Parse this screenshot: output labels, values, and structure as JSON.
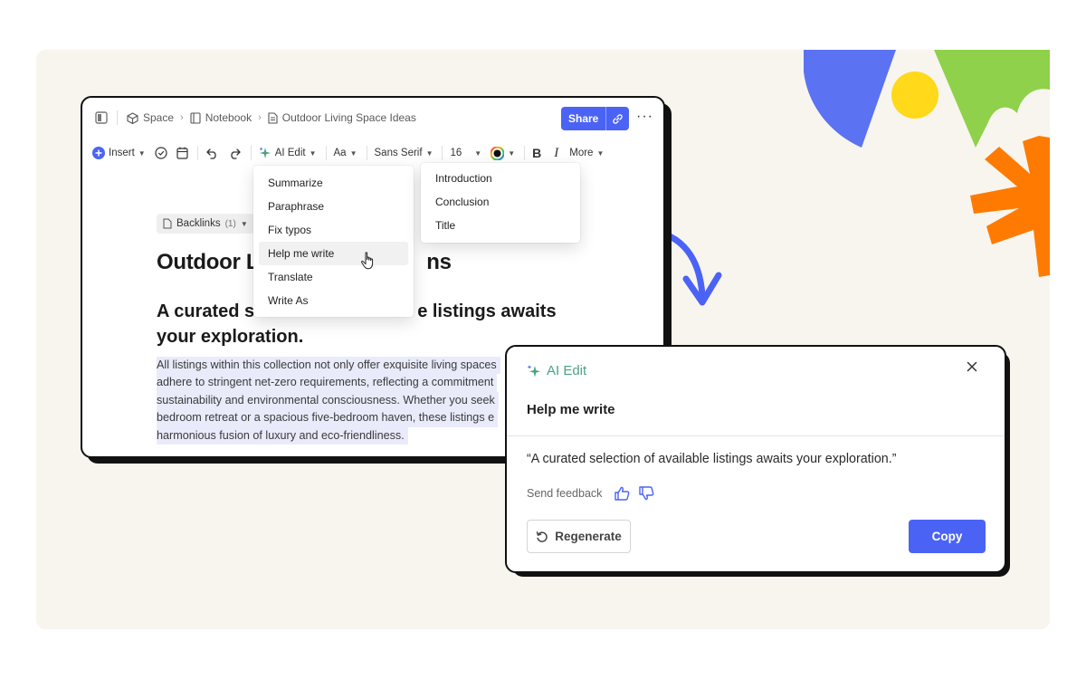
{
  "breadcrumb": [
    "Space",
    "Notebook",
    "Outdoor Living Space Ideas"
  ],
  "header": {
    "share_label": "Share",
    "more_label": "···"
  },
  "toolbar": {
    "insert": "Insert",
    "ai_edit": "AI Edit",
    "text_style": "Aa",
    "font": "Sans Serif",
    "size": "16",
    "bold": "B",
    "italic": "I",
    "more": "More"
  },
  "backlinks": {
    "label": "Backlinks",
    "count": "(1)"
  },
  "document": {
    "title_start": "Outdoor L",
    "title_end": "ns",
    "subtitle_start": "A curated s",
    "subtitle_end": "e listings awaits",
    "subtitle_line2": "your exploration.",
    "body_lines": [
      "All listings within this collection not only offer exquisite living spaces",
      "adhere to stringent net-zero requirements, reflecting a commitment",
      "sustainability and environmental consciousness. Whether you seek",
      "bedroom retreat or a spacious five-bedroom haven, these listings e",
      "harmonious fusion of luxury and eco-friendliness."
    ]
  },
  "ai_menu": [
    "Summarize",
    "Paraphrase",
    "Fix typos",
    "Help me write",
    "Translate",
    "Write As"
  ],
  "sub_menu": [
    "Introduction",
    "Conclusion",
    "Title"
  ],
  "panel": {
    "title": "AI Edit",
    "subtitle": "Help me write",
    "quote": "“A curated selection of available listings awaits your exploration.”",
    "feedback_label": "Send feedback",
    "regenerate": "Regenerate",
    "copy": "Copy"
  },
  "colors": {
    "accent": "#4b63f5",
    "ai_green": "#4aa382",
    "canvas": "#f8f5ee",
    "shape_blue": "#5b72f3",
    "shape_yellow": "#ffd91a",
    "shape_green": "#8fd14b",
    "shape_orange": "#ff7a00"
  }
}
